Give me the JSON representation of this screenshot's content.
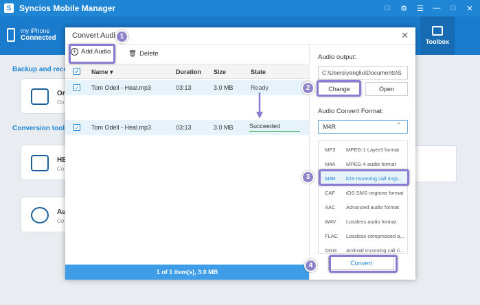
{
  "app": {
    "title": "Syncios Mobile Manager",
    "device_name": "my iPhone",
    "device_status": "Connected",
    "toolbox_label": "Toolbox"
  },
  "background": {
    "section1": "Backup and reco",
    "section2": "Conversion tool",
    "card1_title": "On",
    "card1_sub": "On",
    "card2_title": "HE",
    "card2_sub": "Co",
    "card3_title": "Au",
    "card3_sub": "Co"
  },
  "dialog": {
    "title": "Convert Audio",
    "close": "✕",
    "add_audio": "Add Audio",
    "delete": "Delete",
    "columns": {
      "name": "Name",
      "duration": "Duration",
      "size": "Size",
      "state": "State"
    },
    "rows": [
      {
        "name": "Tom Odell - Heal.mp3",
        "duration": "03:13",
        "size": "3.0 MB",
        "state": "Ready"
      },
      {
        "name": "Tom Odell - Heal.mp3",
        "duration": "03:13",
        "size": "3.0 MB",
        "state": "Succeeded"
      }
    ],
    "footer": "1 of 1 item(s), 3.0 MB",
    "audio_output_label": "Audio output:",
    "audio_output_path": "C:\\Users\\yangliu\\Documents\\S",
    "change": "Change",
    "open": "Open",
    "format_label": "Audio Convert Format:",
    "format_selected": "M4R",
    "formats": [
      {
        "fmt": "MP3",
        "desc": "MPEG-1 Layer3 format"
      },
      {
        "fmt": "M4A",
        "desc": "MPEG-4 audio format"
      },
      {
        "fmt": "M4R",
        "desc": "iOS Incoming call rington..."
      },
      {
        "fmt": "CAF",
        "desc": "iOS SMS ringtone format"
      },
      {
        "fmt": "AAC",
        "desc": "Advanced audio format"
      },
      {
        "fmt": "WAV",
        "desc": "Lossless audio format"
      },
      {
        "fmt": "FLAC",
        "desc": "Lossless compressed a..."
      },
      {
        "fmt": "OGG",
        "desc": "Android Incoming call ri..."
      }
    ],
    "convert": "Convert"
  },
  "callouts": [
    "1",
    "2",
    "3",
    "4"
  ],
  "colors": {
    "accent": "#1f86d6",
    "callout": "#8f83c9",
    "success": "#2fa84f"
  }
}
